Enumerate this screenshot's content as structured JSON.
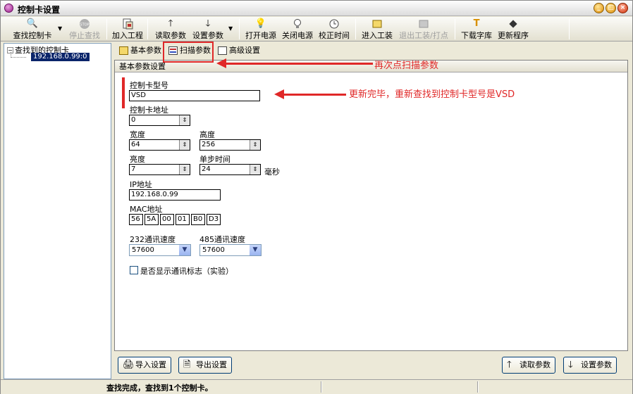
{
  "window": {
    "title": "控制卡设置",
    "min_label": "_",
    "max_label": "□",
    "close_label": "×"
  },
  "toolbar": {
    "find_card": "查找控制卡",
    "stop_find": "停止查找",
    "add_project": "加入工程",
    "read_params": "读取参数",
    "set_params": "设置参数",
    "power_on": "打开电源",
    "power_off": "关闭电源",
    "calibrate_time": "校正时间",
    "enter_factory": "进入工装",
    "exit_factory": "退出工装/打点",
    "download_font": "下载字库",
    "update_program": "更新程序"
  },
  "tree": {
    "root": "查找到的控制卡",
    "child": "192.168.0.99:0",
    "expander": "−"
  },
  "tabs": {
    "basic": "基本参数",
    "scan": "扫描参数",
    "advanced": "高级设置"
  },
  "group": {
    "title": "基本参数设置"
  },
  "form": {
    "card_model_label": "控制卡型号",
    "card_model_value": "VSD",
    "card_addr_label": "控制卡地址",
    "card_addr_value": "0",
    "width_label": "宽度",
    "width_value": "64",
    "height_label": "高度",
    "height_value": "256",
    "brightness_label": "亮度",
    "brightness_value": "7",
    "step_time_label": "单步时间",
    "step_time_value": "24",
    "step_time_unit": "毫秒",
    "ip_label": "IP地址",
    "ip_value": "192.168.0.99",
    "mac_label": "MAC地址",
    "mac_values": [
      "56",
      "5A",
      "00",
      "01",
      "B0",
      "D3"
    ],
    "baud232_label": "232通讯速度",
    "baud232_value": "57600",
    "baud485_label": "485通讯速度",
    "baud485_value": "57600",
    "show_log_label": "是否显示通讯标志（实验）"
  },
  "buttons": {
    "import": "导入设置",
    "export": "导出设置",
    "read": "读取参数",
    "set": "设置参数"
  },
  "status": {
    "text": "查找完成，查找到1个控制卡。"
  },
  "annotations": {
    "click_scan": "再次点扫描参数",
    "model_found": "更新完毕，重新查找到控制卡型号是VSD"
  },
  "colors": {
    "annotation_red": "#e02828",
    "selection_blue": "#0a246a"
  }
}
